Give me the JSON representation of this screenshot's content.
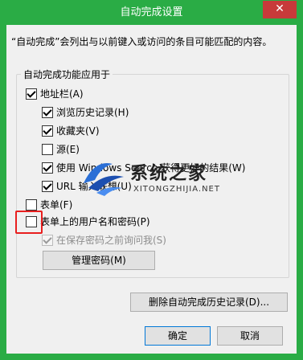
{
  "window": {
    "title": "自动完成设置",
    "close_glyph": "✕"
  },
  "description": "“自动完成”会列出与以前键入或访问的条目可能匹配的内容。",
  "group": {
    "legend": "自动完成功能应用于",
    "items": [
      {
        "label": "地址栏(A)",
        "checked": true,
        "enabled": true
      },
      {
        "label": "浏览历史记录(H)",
        "checked": true,
        "enabled": true
      },
      {
        "label": "收藏夹(V)",
        "checked": true,
        "enabled": true
      },
      {
        "label": "源(E)",
        "checked": false,
        "enabled": true
      },
      {
        "label": "使用 Windows Search 获得更好的结果(W)",
        "checked": true,
        "enabled": true
      },
      {
        "label": "URL 输入联想(U)",
        "checked": true,
        "enabled": true
      },
      {
        "label": "表单(F)",
        "checked": false,
        "enabled": true
      },
      {
        "label": "表单上的用户名和密码(P)",
        "checked": false,
        "enabled": true
      },
      {
        "label": "在保存密码之前询问我(S)",
        "checked": true,
        "enabled": false
      }
    ],
    "manage_passwords_button": "管理密码(M)"
  },
  "delete_history_button": "删除自动完成历史记录(D)...",
  "ok_button": "确定",
  "cancel_button": "取消",
  "watermark": {
    "text": "系统之家",
    "sub": "XITONGZHIJIA.NET"
  },
  "colors": {
    "frame": "#2aac45",
    "close": "#c73a3a",
    "highlight": "#e81e1e"
  }
}
